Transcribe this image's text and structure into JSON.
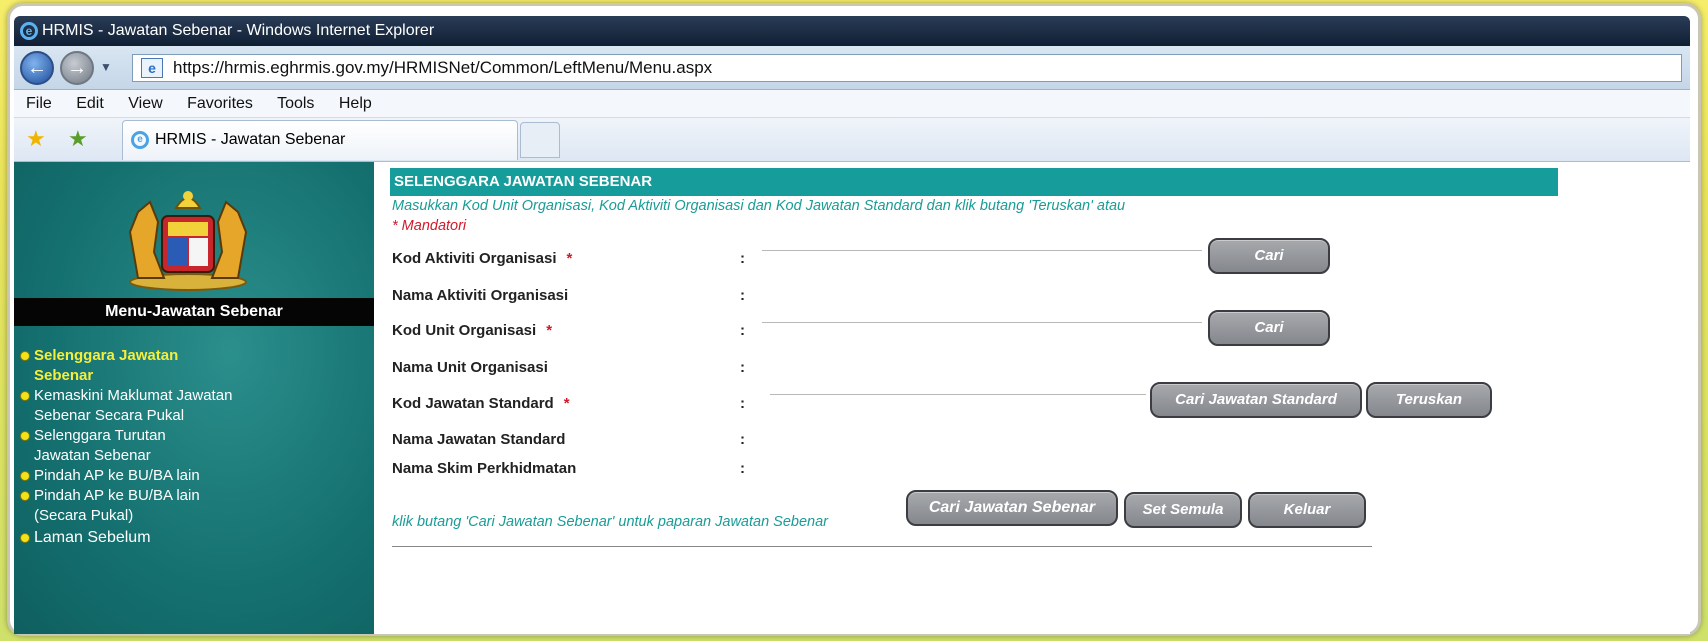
{
  "window": {
    "title": "HRMIS - Jawatan Sebenar - Windows Internet Explorer"
  },
  "browser": {
    "url": "https://hrmis.eghrmis.gov.my/HRMISNet/Common/LeftMenu/Menu.aspx",
    "menu": [
      "File",
      "Edit",
      "View",
      "Favorites",
      "Tools",
      "Help"
    ],
    "tab_title": "HRMIS - Jawatan Sebenar"
  },
  "sidebar": {
    "title": "Menu-Jawatan Sebenar",
    "items": [
      {
        "label": "Selenggara Jawatan Sebenar",
        "active": true
      },
      {
        "label": "Kemaskini Maklumat Jawatan Sebenar Secara Pukal",
        "active": false
      },
      {
        "label": "Selenggara Turutan Jawatan Sebenar",
        "active": false
      },
      {
        "label": "Pindah AP ke BU/BA lain",
        "active": false
      },
      {
        "label": "Pindah AP ke BU/BA lain (Secara Pukal)",
        "active": false
      },
      {
        "label": "Laman Sebelum",
        "active": false
      }
    ]
  },
  "main": {
    "header": "SELENGGARA JAWATAN SEBENAR",
    "instruction": "Masukkan Kod Unit Organisasi, Kod Aktiviti Organisasi dan Kod Jawatan Standard dan klik butang 'Teruskan' atau",
    "mandatory_note": "* Mandatori",
    "fields": {
      "kod_aktiviti": {
        "label": "Kod Aktiviti Organisasi",
        "required": "*",
        "colon": ":",
        "value": ""
      },
      "nama_aktiviti": {
        "label": "Nama Aktiviti Organisasi",
        "colon": ":"
      },
      "kod_unit": {
        "label": "Kod Unit Organisasi",
        "required": "*",
        "colon": ":",
        "value": ""
      },
      "nama_unit": {
        "label": "Nama Unit Organisasi",
        "colon": ":"
      },
      "kod_jawatan": {
        "label": "Kod Jawatan Standard",
        "required": "*",
        "colon": ":",
        "value": ""
      },
      "nama_jawatan": {
        "label": "Nama Jawatan Standard",
        "colon": ":"
      },
      "nama_skim": {
        "label": "Nama Skim Perkhidmatan",
        "colon": ":"
      }
    },
    "buttons": {
      "cari": "Cari",
      "cari_jawatan_standard": "Cari Jawatan Standard",
      "teruskan": "Teruskan",
      "cari_jawatan_sebenar": "Cari Jawatan Sebenar",
      "set_semula": "Set Semula",
      "keluar": "Keluar"
    },
    "bottom_instruction": "klik butang 'Cari Jawatan Sebenar' untuk paparan Jawatan Sebenar"
  },
  "colors": {
    "teal_header": "#169c9a",
    "sidebar_bg": "#14706f",
    "required_red": "#d0192a",
    "active_yellow": "#f6ee3a"
  },
  "icons": [
    "ie-logo-icon",
    "back-arrow-icon",
    "forward-arrow-icon",
    "page-icon",
    "favorites-star-icon",
    "add-favorites-icon",
    "malaysia-crest-icon",
    "bullet-icon"
  ]
}
